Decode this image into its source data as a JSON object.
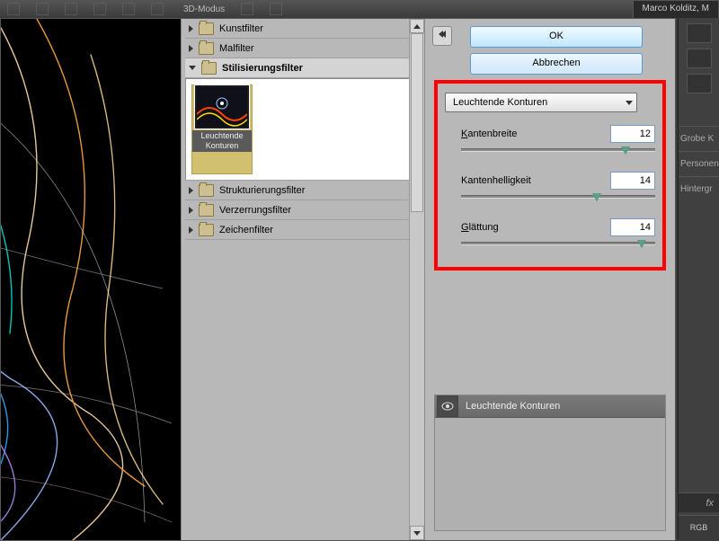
{
  "toolbar": {
    "mode_label": "3D-Modus",
    "user_label": "Marco Kolditz, M"
  },
  "right_dock": {
    "items": [
      "Grobe K",
      "Personen",
      "Hintergr"
    ],
    "fx_label": "fx",
    "mode_label": "RGB"
  },
  "dialog": {
    "buttons": {
      "ok": "OK",
      "cancel": "Abbrechen"
    },
    "collapse_glyph": "«",
    "categories": [
      {
        "label": "Kunstfilter",
        "open": false
      },
      {
        "label": "Malfilter",
        "open": false
      },
      {
        "label": "Stilisierungsfilter",
        "open": true,
        "selected": true,
        "thumbs": [
          {
            "label": "Leuchtende Konturen",
            "selected": true
          }
        ]
      },
      {
        "label": "Strukturierungsfilter",
        "open": false
      },
      {
        "label": "Verzerrungsfilter",
        "open": false
      },
      {
        "label": "Zeichenfilter",
        "open": false
      }
    ],
    "filter_select": "Leuchtende Konturen",
    "params": [
      {
        "key": "kantenbreite",
        "label_pre": "K",
        "label_rest": "antenbreite",
        "value": 12,
        "min": 1,
        "max": 14
      },
      {
        "key": "kantenhelligkeit",
        "label_pre": "",
        "label_rest": "Kantenhelligkeit",
        "value": 14,
        "min": 0,
        "max": 20
      },
      {
        "key": "glaettung",
        "label_pre": "G",
        "label_rest": "lättung",
        "value": 14,
        "min": 1,
        "max": 15
      }
    ],
    "applied_filters": [
      {
        "label": "Leuchtende Konturen",
        "visible": true
      }
    ]
  }
}
